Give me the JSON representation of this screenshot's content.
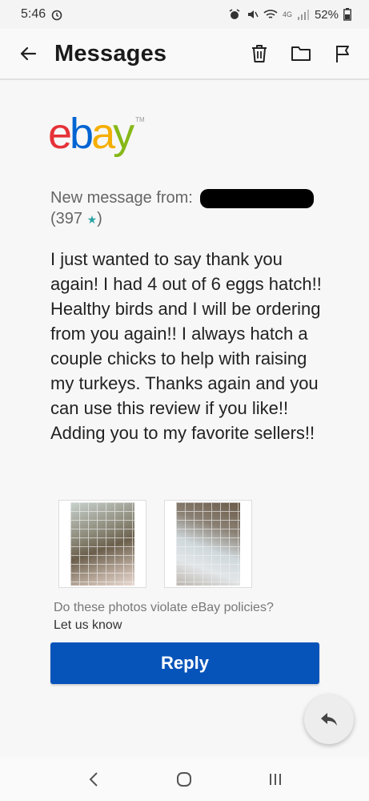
{
  "status_bar": {
    "time": "5:46",
    "network": "4G",
    "battery": "52%"
  },
  "app_bar": {
    "title": "Messages"
  },
  "brand": {
    "logo_letters": [
      "e",
      "b",
      "a",
      "y"
    ],
    "tm": "TM",
    "colors": {
      "e": "#e53238",
      "b": "#0064d2",
      "a": "#f5af02",
      "y": "#86b817"
    }
  },
  "message": {
    "from_label": "New message from:",
    "rating_open": "(397",
    "rating_close": ")",
    "body": "I just wanted to say thank you again! I had 4 out of 6 eggs hatch!! Healthy birds and I will be ordering from you again!! I always hatch a couple chicks to help with raising my turkeys. Thanks again and you can use this review if you like!! Adding you to my favorite sellers!!"
  },
  "photos": {
    "policy_question": "Do these photos violate eBay policies?",
    "policy_link": "Let us know"
  },
  "actions": {
    "reply_label": "Reply"
  },
  "icons": {
    "back": "arrow-left-icon",
    "delete": "trash-icon",
    "folder": "folder-icon",
    "report": "flag-icon",
    "fab": "reply-arrow-icon",
    "nav_back": "chevron-left-icon",
    "nav_home": "home-circle-icon",
    "nav_recents": "recents-icon"
  },
  "theme": {
    "reply_button_color": "#0654ba",
    "rating_star_color": "#2ba3a3"
  }
}
